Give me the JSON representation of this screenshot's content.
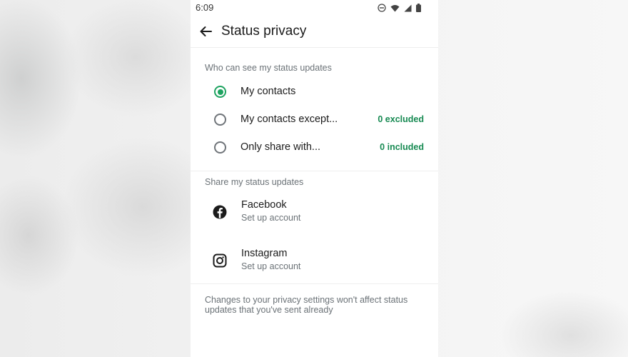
{
  "status_bar": {
    "time": "6:09",
    "icons": [
      "do-not-disturb-icon",
      "wifi-icon",
      "signal-icon",
      "battery-icon"
    ]
  },
  "app_bar": {
    "title": "Status privacy",
    "back_icon": "arrow-back-icon"
  },
  "who_can_see": {
    "header": "Who can see my status updates",
    "options": [
      {
        "label": "My contacts",
        "count": "",
        "selected": true
      },
      {
        "label": "My contacts except...",
        "count": "0 excluded",
        "selected": false
      },
      {
        "label": "Only share with...",
        "count": "0 included",
        "selected": false
      }
    ]
  },
  "share_updates": {
    "header": "Share my status updates",
    "accounts": [
      {
        "name": "Facebook",
        "subtitle": "Set up account",
        "icon": "facebook-icon"
      },
      {
        "name": "Instagram",
        "subtitle": "Set up account",
        "icon": "instagram-icon"
      }
    ]
  },
  "footer_note": "Changes to your privacy settings won't affect status updates that you've sent already",
  "colors": {
    "accent": "#1ea360",
    "count_text": "#178a52",
    "secondary_text": "#6b7277",
    "primary_text": "#1b1b1b"
  }
}
